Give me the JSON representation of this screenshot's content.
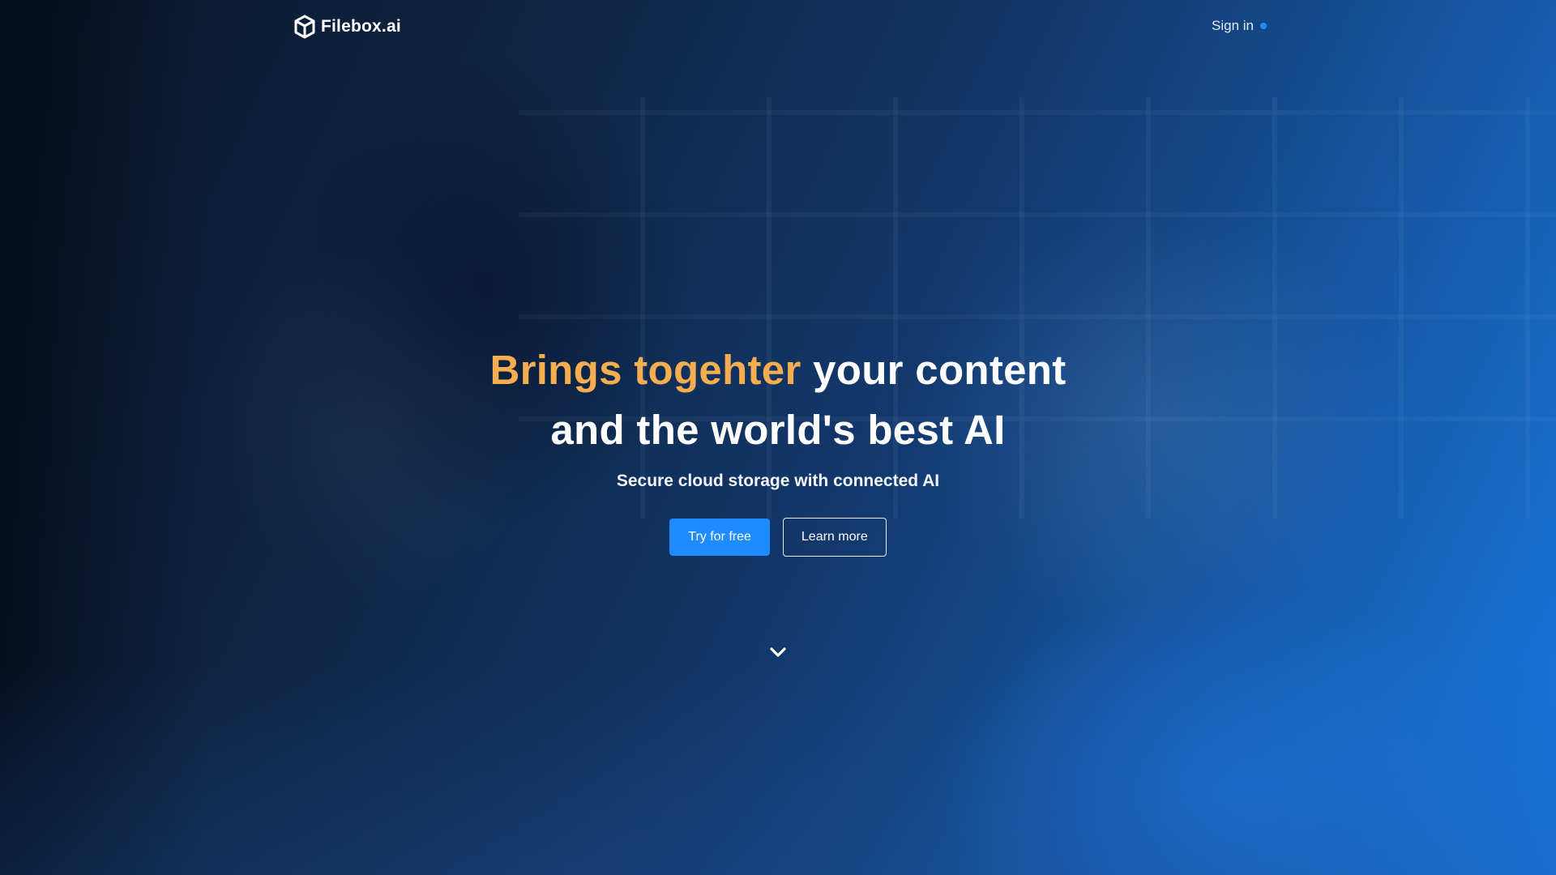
{
  "header": {
    "brand_name": "Filebox.ai",
    "brand_icon": "box-logo-icon",
    "signin_label": "Sign in",
    "signin_indicator_color": "#1e8cff"
  },
  "hero": {
    "headline_accent": "Brings togehter",
    "headline_rest_line1": " your content",
    "headline_line2": "and the world's best AI",
    "subheadline": "Secure cloud storage with connected AI",
    "primary_cta_label": "Try for free",
    "secondary_cta_label": "Learn more",
    "scroll_icon": "chevron-down-icon"
  },
  "colors": {
    "accent": "#f4ad4f",
    "primary": "#1e8cff",
    "text": "#ffffff"
  }
}
